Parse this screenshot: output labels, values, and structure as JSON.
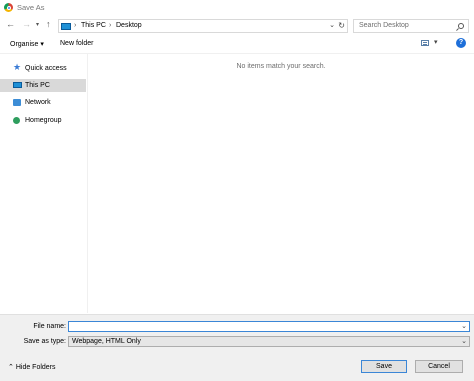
{
  "window": {
    "title": "Save As"
  },
  "address": {
    "crumbs": [
      "This PC",
      "Desktop"
    ],
    "search_placeholder": "Search Desktop"
  },
  "toolbar": {
    "organise": "Organise ▾",
    "new_folder": "New folder"
  },
  "sidebar": {
    "items": [
      {
        "label": "Quick access",
        "icon": "star-icon",
        "selected": false
      },
      {
        "label": "This PC",
        "icon": "computer-icon",
        "selected": true
      },
      {
        "label": "Network",
        "icon": "network-icon",
        "selected": false
      },
      {
        "label": "Homegroup",
        "icon": "homegroup-icon",
        "selected": false
      }
    ]
  },
  "content": {
    "empty_message": "No items match your search."
  },
  "form": {
    "file_name_label": "File name:",
    "file_name_value": "",
    "save_type_label": "Save as type:",
    "save_type_value": "Webpage, HTML Only"
  },
  "footer": {
    "hide_folders": "Hide Folders",
    "save": "Save",
    "cancel": "Cancel"
  },
  "colors": {
    "accent": "#1e90d6",
    "selected_bg": "#d9d9d9",
    "footer_bg": "#f0f0f0"
  }
}
